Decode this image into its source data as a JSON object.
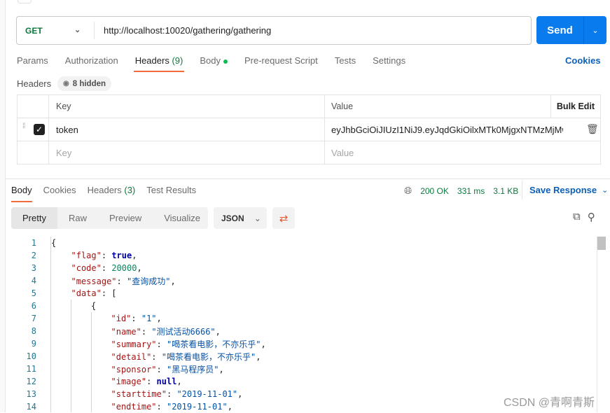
{
  "request": {
    "method": "GET",
    "url": "http://localhost:10020/gathering/gathering",
    "send_label": "Send"
  },
  "req_tabs": [
    {
      "label": "Params"
    },
    {
      "label": "Authorization"
    },
    {
      "label": "Headers",
      "count": "(9)"
    },
    {
      "label": "Body"
    },
    {
      "label": "Pre-request Script"
    },
    {
      "label": "Tests"
    },
    {
      "label": "Settings"
    }
  ],
  "cookies_label": "Cookies",
  "headers": {
    "label": "Headers",
    "hidden_label": "8 hidden",
    "col_key": "Key",
    "col_value": "Value",
    "bulk_edit": "Bulk Edit",
    "rows": [
      {
        "key": "token",
        "value": "eyJhbGciOiJIUzI1NiJ9.eyJqdGkiOilxMTk0MjgxNTMzMjMwN...",
        "checked": true
      }
    ],
    "key_placeholder": "Key",
    "value_placeholder": "Value"
  },
  "response": {
    "tabs": [
      {
        "label": "Body"
      },
      {
        "label": "Cookies"
      },
      {
        "label": "Headers",
        "count": "(3)"
      },
      {
        "label": "Test Results"
      }
    ],
    "status": "200 OK",
    "time": "331 ms",
    "size": "3.1 KB",
    "save_label": "Save Response",
    "views": [
      "Pretty",
      "Raw",
      "Preview",
      "Visualize"
    ],
    "format": "JSON",
    "lines": [
      {
        "n": "1",
        "indent": 0,
        "segs": [
          [
            "p",
            "{"
          ]
        ]
      },
      {
        "n": "2",
        "indent": 1,
        "segs": [
          [
            "k",
            "\"flag\""
          ],
          [
            "p",
            ": "
          ],
          [
            "b",
            "true"
          ],
          [
            "p",
            ","
          ]
        ]
      },
      {
        "n": "3",
        "indent": 1,
        "segs": [
          [
            "k",
            "\"code\""
          ],
          [
            "p",
            ": "
          ],
          [
            "n",
            "20000"
          ],
          [
            "p",
            ","
          ]
        ]
      },
      {
        "n": "4",
        "indent": 1,
        "segs": [
          [
            "k",
            "\"message\""
          ],
          [
            "p",
            ": "
          ],
          [
            "s",
            "\"查询成功\""
          ],
          [
            "p",
            ","
          ]
        ]
      },
      {
        "n": "5",
        "indent": 1,
        "segs": [
          [
            "k",
            "\"data\""
          ],
          [
            "p",
            ": ["
          ]
        ]
      },
      {
        "n": "6",
        "indent": 2,
        "segs": [
          [
            "p",
            "{"
          ]
        ]
      },
      {
        "n": "7",
        "indent": 3,
        "segs": [
          [
            "k",
            "\"id\""
          ],
          [
            "p",
            ": "
          ],
          [
            "s",
            "\"1\""
          ],
          [
            "p",
            ","
          ]
        ]
      },
      {
        "n": "8",
        "indent": 3,
        "segs": [
          [
            "k",
            "\"name\""
          ],
          [
            "p",
            ": "
          ],
          [
            "s",
            "\"测试活动6666\""
          ],
          [
            "p",
            ","
          ]
        ]
      },
      {
        "n": "9",
        "indent": 3,
        "segs": [
          [
            "k",
            "\"summary\""
          ],
          [
            "p",
            ": "
          ],
          [
            "s",
            "\"喝茶看电影，不亦乐乎\""
          ],
          [
            "p",
            ","
          ]
        ]
      },
      {
        "n": "10",
        "indent": 3,
        "segs": [
          [
            "k",
            "\"detail\""
          ],
          [
            "p",
            ": "
          ],
          [
            "s",
            "\"喝茶看电影，不亦乐乎\""
          ],
          [
            "p",
            ","
          ]
        ]
      },
      {
        "n": "11",
        "indent": 3,
        "segs": [
          [
            "k",
            "\"sponsor\""
          ],
          [
            "p",
            ": "
          ],
          [
            "s",
            "\"黑马程序员\""
          ],
          [
            "p",
            ","
          ]
        ]
      },
      {
        "n": "12",
        "indent": 3,
        "segs": [
          [
            "k",
            "\"image\""
          ],
          [
            "p",
            ": "
          ],
          [
            "b",
            "null"
          ],
          [
            "p",
            ","
          ]
        ]
      },
      {
        "n": "13",
        "indent": 3,
        "segs": [
          [
            "k",
            "\"starttime\""
          ],
          [
            "p",
            ": "
          ],
          [
            "s",
            "\"2019-11-01\""
          ],
          [
            "p",
            ","
          ]
        ]
      },
      {
        "n": "14",
        "indent": 3,
        "segs": [
          [
            "k",
            "\"endtime\""
          ],
          [
            "p",
            ": "
          ],
          [
            "s",
            "\"2019-11-01\""
          ],
          [
            "p",
            ","
          ]
        ]
      }
    ]
  },
  "watermark": "CSDN @青啊青斯"
}
